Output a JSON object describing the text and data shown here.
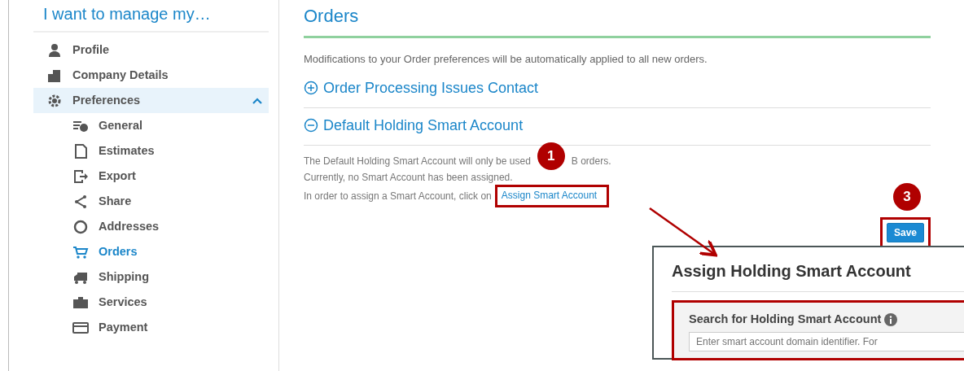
{
  "sidebar": {
    "title": "I want to manage my…",
    "items": [
      {
        "label": "Profile",
        "selected": false
      },
      {
        "label": "Company Details",
        "selected": false
      },
      {
        "label": "Preferences",
        "selected": true,
        "expanded": true,
        "children": [
          {
            "label": "General",
            "selected": false
          },
          {
            "label": "Estimates",
            "selected": false
          },
          {
            "label": "Export",
            "selected": false
          },
          {
            "label": "Share",
            "selected": false
          },
          {
            "label": "Addresses",
            "selected": false
          },
          {
            "label": "Orders",
            "selected": true
          },
          {
            "label": "Shipping",
            "selected": false
          },
          {
            "label": "Services",
            "selected": false
          },
          {
            "label": "Payment",
            "selected": false
          }
        ]
      }
    ]
  },
  "main": {
    "title": "Orders",
    "intro": "Modifications to your Order preferences will be automatically applied to all new orders.",
    "sections": [
      {
        "title": "Order Processing Issues Contact",
        "expanded": false
      },
      {
        "title": "Default Holding Smart Account",
        "expanded": true
      }
    ],
    "note_before": "The Default Holding Smart Account will only be used",
    "note_after": "B orders.",
    "status": "Currently, no Smart Account has been assigned.",
    "assign_text": "In order to assign a Smart Account, click on",
    "assign_link": "Assign Smart Account",
    "save": "Save"
  },
  "callouts": [
    "1",
    "3"
  ],
  "dialog": {
    "title": "Assign Holding Smart Account",
    "search_label": "Search for Holding Smart Account",
    "placeholder": "Enter smart account domain identifier. For"
  }
}
